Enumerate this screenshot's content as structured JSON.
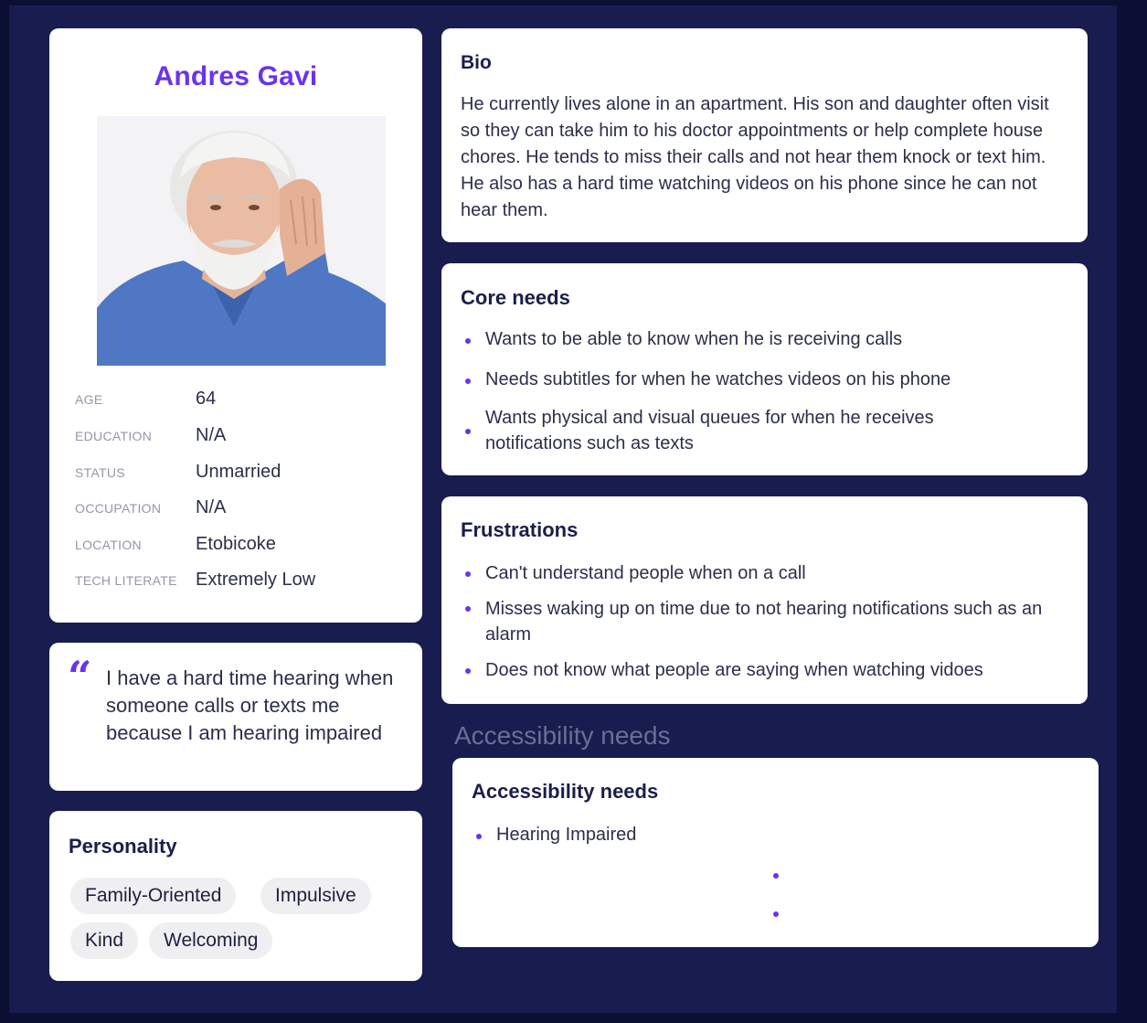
{
  "persona": {
    "name": "Andres Gavi",
    "attributes": [
      {
        "label": "AGE",
        "value": "64"
      },
      {
        "label": "EDUCATION",
        "value": "N/A"
      },
      {
        "label": "STATUS",
        "value": "Unmarried"
      },
      {
        "label": "OCCUPATION",
        "value": "N/A"
      },
      {
        "label": "LOCATION",
        "value": "Etobicoke"
      },
      {
        "label": "TECH LITERATE",
        "value": "Extremely Low"
      }
    ]
  },
  "quote": {
    "mark": "“",
    "text": "I have a hard time hearing when someone calls or texts me because I am hearing impaired"
  },
  "personality": {
    "title": "Personality",
    "tags": [
      "Family-Oriented",
      "Impulsive",
      "Kind",
      "Welcoming"
    ]
  },
  "bio": {
    "title": "Bio",
    "text": "He currently lives alone in an apartment. His son and daughter often visit so they can take him to his doctor appointments or help complete house chores. He tends to miss their calls and not hear them knock or text him.  He also has a hard time watching videos on his phone since he can not hear them."
  },
  "core_needs": {
    "title": "Core needs",
    "items": [
      "Wants to be able to know when he is receiving calls",
      "Needs subtitles for when he watches videos on his phone",
      "Wants physical and visual queues for when he receives notifications such as texts"
    ]
  },
  "frustrations": {
    "title": "Frustrations",
    "items": [
      "Can't understand people when on a call",
      "Misses waking up on time due to not hearing notifications such as an alarm",
      "Does not know what people are saying when watching vidoes"
    ]
  },
  "accessibility": {
    "section_label": "Accessibility needs",
    "title": "Accessibility needs",
    "items": [
      "Hearing Impaired"
    ]
  },
  "colors": {
    "accent": "#6a32f0",
    "background": "#181c4f",
    "card": "#ffffff"
  }
}
